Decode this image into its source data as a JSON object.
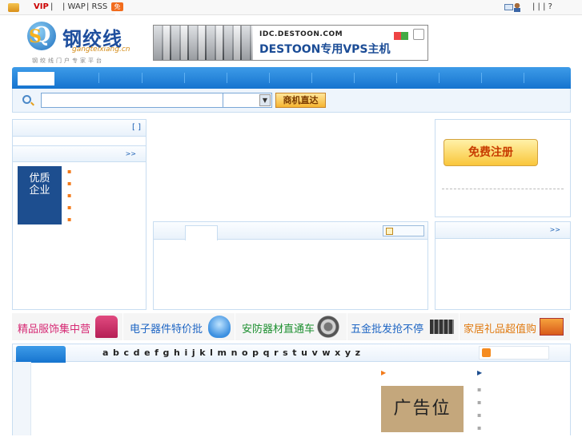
{
  "topbar": {
    "vip": "VIP",
    "sep1": "|",
    "wap": "| WAP",
    "rss": "| RSS",
    "free_badge": "免费",
    "right_seps": "|     |     |     ?"
  },
  "logo": {
    "name": "钢绞线",
    "domain": "gangteixiang.cn",
    "slogan": "钢绞线门户专家平台"
  },
  "banner": {
    "url": "IDC.DESTOON.COM",
    "title": "DESTOON专用VPS主机"
  },
  "search": {
    "value": "",
    "select_value": "",
    "button_label": "商机直达"
  },
  "left_panel": {
    "brackets": "[     ]",
    "more": ">>",
    "quality_label": "优质企业"
  },
  "right_panel": {
    "register_label": "免费注册",
    "more": ">>"
  },
  "promos": [
    {
      "label": "精品服饰集中营",
      "color": "#d62a74"
    },
    {
      "label": "电子器件特价批",
      "color": "#1f66c4"
    },
    {
      "label": "安防器材直通车",
      "color": "#1c8f2f"
    },
    {
      "label": "五金批发抢不停",
      "color": "#1f66c4"
    },
    {
      "label": "家居礼品超值购",
      "color": "#e07a11"
    }
  ],
  "letters": [
    "a",
    "b",
    "c",
    "d",
    "e",
    "f",
    "g",
    "h",
    "i",
    "j",
    "k",
    "l",
    "m",
    "n",
    "o",
    "p",
    "q",
    "r",
    "s",
    "t",
    "u",
    "v",
    "w",
    "x",
    "y",
    "z"
  ],
  "ad_label": "广告位",
  "colors": {
    "nav_blue": "#1674cf",
    "panel_border": "#c8ddf1",
    "accent_orange": "#f27a1a"
  }
}
